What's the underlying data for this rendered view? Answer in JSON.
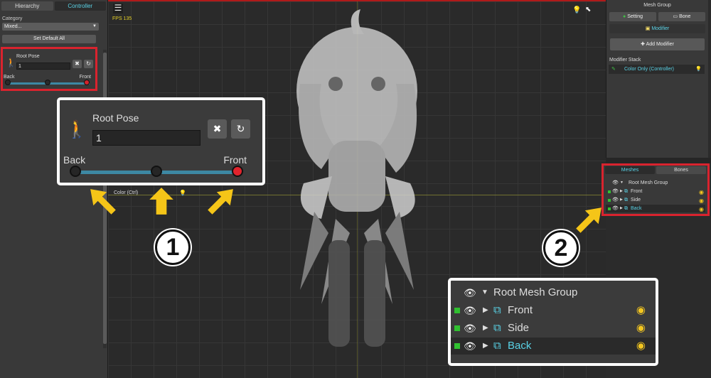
{
  "left_panel": {
    "tabs": [
      {
        "label": "Hierarchy"
      },
      {
        "label": "Controller"
      }
    ],
    "category_label": "Category",
    "category_value": "Mixed...",
    "set_default_label": "Set Default All",
    "pose": {
      "title": "Root Pose",
      "value": "1",
      "back_label": "Back",
      "front_label": "Front"
    }
  },
  "viewport": {
    "fps": "FPS 135",
    "color_hint": "Color (Ctrl)",
    "icons": [
      "menu-icon",
      "bulb-icon",
      "cursor-icon"
    ]
  },
  "right_panel": {
    "header": "Mesh Group",
    "setting_label": "Setting",
    "bone_label": "Bone",
    "modifier_label": "Modifier",
    "add_modifier_label": "Add Modifier",
    "stack_label": "Modifier Stack",
    "stack_item": "Color Only (Controller)",
    "mesh_tabs": [
      {
        "label": "Meshes"
      },
      {
        "label": "Bones"
      }
    ],
    "root_group": "Root Mesh Group",
    "meshes": [
      {
        "name": "Front"
      },
      {
        "name": "Side"
      },
      {
        "name": "Back"
      }
    ]
  },
  "callouts": {
    "zoom_pose": {
      "title": "Root Pose",
      "value": "1",
      "back_label": "Back",
      "front_label": "Front"
    },
    "zoom_meshes": {
      "root": "Root Mesh Group",
      "items": [
        {
          "name": "Front"
        },
        {
          "name": "Side"
        },
        {
          "name": "Back"
        }
      ]
    },
    "markers": [
      {
        "label": "1"
      },
      {
        "label": "2"
      }
    ]
  },
  "colors": {
    "accent": "#59d2e6",
    "highlight": "#d9232e",
    "arrow": "#f5c518",
    "green": "#41c045"
  }
}
